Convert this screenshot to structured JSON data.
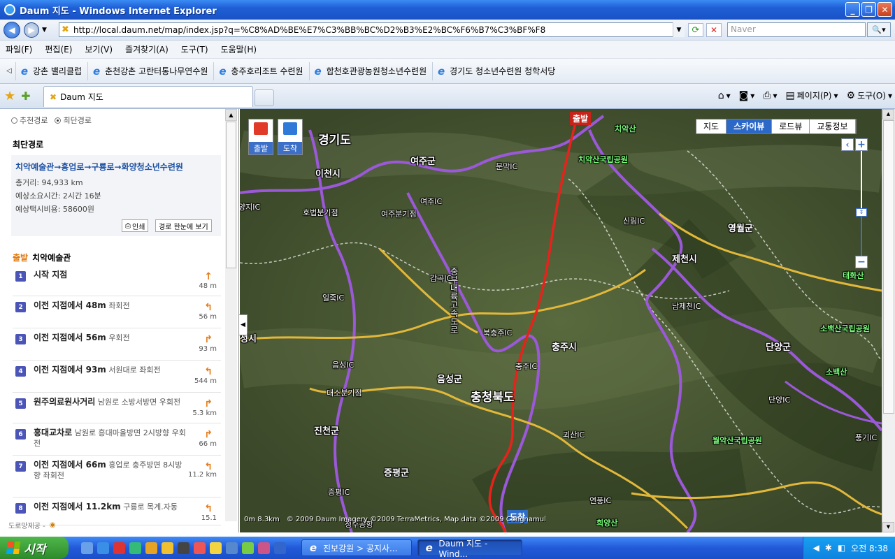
{
  "window": {
    "title": "Daum 지도 - Windows Internet Explorer"
  },
  "address": {
    "url": "http://local.daum.net/map/index.jsp?q=%C8%AD%BE%E7%C3%BB%BC%D2%B3%E2%BC%F6%B7%C3%BF%F8",
    "search_placeholder": "Naver"
  },
  "menu": [
    "파일(F)",
    "편집(E)",
    "보기(V)",
    "즐겨찾기(A)",
    "도구(T)",
    "도움말(H)"
  ],
  "links": [
    "강촌 밸리클럽",
    "춘천강촌 고란터통나무연수원",
    "충주호리조트 수련원",
    "합천호관광농원청소년수련원",
    "경기도 청소년수련원 청학서당"
  ],
  "tab": {
    "label": "Daum 지도"
  },
  "tools": {
    "page": "페이지(P)",
    "tools": "도구(O)"
  },
  "route": {
    "options": [
      "추천경로",
      "최단경로"
    ],
    "section_title": "최단경로",
    "path": "치악예술관→흥업로→구룡로→화양청소년수련원",
    "distance": "총거리: 94,933 km",
    "time": "예상소요시간: 2시간 16분",
    "taxi": "예상택시비용: 58600원",
    "print_btn": "인쇄",
    "overview_btn": "경로 한눈에 보기",
    "start_label": "출발",
    "start_name": "치악예술관",
    "steps": [
      {
        "num": "1",
        "bold": "시작 지점",
        "rest": "",
        "dist": "48 m",
        "arrow": "↑"
      },
      {
        "num": "2",
        "bold": "이전 지점에서 48m",
        "rest": "좌회전",
        "dist": "56 m",
        "arrow": "↰"
      },
      {
        "num": "3",
        "bold": "이전 지점에서 56m",
        "rest": "우회전",
        "dist": "93 m",
        "arrow": "↱"
      },
      {
        "num": "4",
        "bold": "이전 지점에서 93m",
        "rest": "서원대로 좌회전",
        "dist": "544 m",
        "arrow": "↰"
      },
      {
        "num": "5",
        "bold": "원주의료원사거리",
        "rest": "남원로 소방서방면 우회전",
        "dist": "5.3 km",
        "arrow": "↱"
      },
      {
        "num": "6",
        "bold": "흥대교차로",
        "rest": "남원로 흥대마을방면 2시방향 우회전",
        "dist": "66 m",
        "arrow": "↱"
      },
      {
        "num": "7",
        "bold": "이전 지점에서 66m",
        "rest": "흥업로 충주방면 8시방향 좌회전",
        "dist": "11.2 km",
        "arrow": "↰"
      },
      {
        "num": "8",
        "bold": "이전 지점에서 11.2km",
        "rest": "구룡로 목계.자동",
        "dist": "15.1",
        "arrow": "↰"
      }
    ],
    "footer": "도로망제공 -"
  },
  "map": {
    "types": [
      "지도",
      "스카이뷰",
      "로드뷰",
      "교통정보"
    ],
    "flag_start": "출발",
    "flag_end": "도착",
    "marker_start": "출발",
    "marker_end": "도착",
    "labels": [
      {
        "t": "경기도",
        "c": "big"
      },
      {
        "t": "충청북도",
        "c": "big"
      },
      {
        "t": "이천시",
        "c": "med"
      },
      {
        "t": "여주군",
        "c": "med"
      },
      {
        "t": "여주IC",
        "c": "sm"
      },
      {
        "t": "문막IC",
        "c": "sm"
      },
      {
        "t": "양지IC",
        "c": "sm"
      },
      {
        "t": "호법분기점",
        "c": "sm"
      },
      {
        "t": "여주분기점",
        "c": "sm"
      },
      {
        "t": "감곡IC",
        "c": "sm"
      },
      {
        "t": "일죽IC",
        "c": "sm"
      },
      {
        "t": "북충주IC",
        "c": "sm"
      },
      {
        "t": "충주시",
        "c": "med"
      },
      {
        "t": "충주IC",
        "c": "sm"
      },
      {
        "t": "음성IC",
        "c": "sm"
      },
      {
        "t": "대소분기점",
        "c": "sm"
      },
      {
        "t": "음성군",
        "c": "med"
      },
      {
        "t": "진천군",
        "c": "med"
      },
      {
        "t": "증평군",
        "c": "med"
      },
      {
        "t": "증평IC",
        "c": "sm"
      },
      {
        "t": "괴산IC",
        "c": "sm"
      },
      {
        "t": "연풍IC",
        "c": "sm"
      },
      {
        "t": "신림IC",
        "c": "sm"
      },
      {
        "t": "제천시",
        "c": "med"
      },
      {
        "t": "남제천IC",
        "c": "sm"
      },
      {
        "t": "영월군",
        "c": "med"
      },
      {
        "t": "단양군",
        "c": "med"
      },
      {
        "t": "단양IC",
        "c": "sm"
      },
      {
        "t": "풍기IC",
        "c": "sm"
      },
      {
        "t": "치악산국립공원",
        "c": "green"
      },
      {
        "t": "소백산국립공원",
        "c": "green"
      },
      {
        "t": "월악산국립공원",
        "c": "green"
      },
      {
        "t": "치악산",
        "c": "green"
      },
      {
        "t": "소백산",
        "c": "green"
      },
      {
        "t": "태화산",
        "c": "green"
      },
      {
        "t": "희양산",
        "c": "green"
      },
      {
        "t": "중부내륙고속도로",
        "c": "sm"
      },
      {
        "t": "청주공항",
        "c": "sm"
      },
      {
        "t": "성시",
        "c": "med"
      }
    ],
    "copyright": "© 2009 Daum  Imagery ©2009 TerraMetrics, Map data ©2009 Congnamul",
    "scale": "0m    8.3km"
  },
  "taskbar": {
    "start": "시작",
    "tasks": [
      "진보강원 > 공지사...",
      "Daum 지도 - Wind..."
    ],
    "time": "오전 8:38"
  }
}
